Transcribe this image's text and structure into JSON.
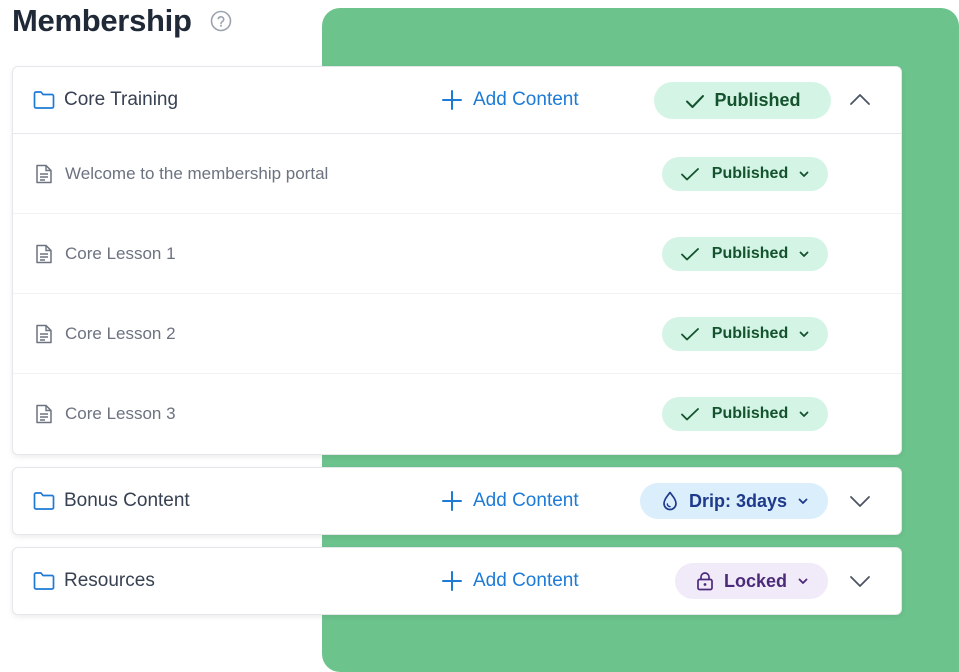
{
  "page": {
    "title": "Membership",
    "help_icon": "question-circle-icon"
  },
  "colors": {
    "accent_green_bg": "#6cc48c",
    "link_blue": "#1d7bd6",
    "published_bg": "#d4f5e5",
    "drip_bg": "#dbeefc",
    "locked_bg": "#f1eaf9"
  },
  "modules": [
    {
      "title": "Core Training",
      "add_label": "Add Content",
      "status": "Published",
      "expanded": true,
      "lessons": [
        {
          "title": "Welcome to the membership portal",
          "status": "Published"
        },
        {
          "title": "Core Lesson 1",
          "status": "Published"
        },
        {
          "title": "Core Lesson 2",
          "status": "Published"
        },
        {
          "title": "Core Lesson 3",
          "status": "Published"
        }
      ]
    },
    {
      "title": "Bonus Content",
      "add_label": "Add Content",
      "status": "Drip: 3days",
      "expanded": false
    },
    {
      "title": "Resources",
      "add_label": "Add Content",
      "status": "Locked",
      "expanded": false
    }
  ]
}
